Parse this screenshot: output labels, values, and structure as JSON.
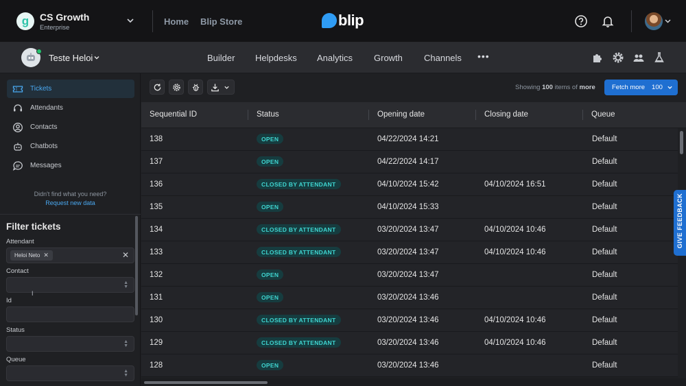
{
  "header": {
    "org_initial": "g",
    "org_name": "CS Growth",
    "org_plan": "Enterprise",
    "nav": [
      "Home",
      "Blip Store"
    ],
    "brand": "blip",
    "icons": [
      "help-circle-icon",
      "bell-icon",
      "avatar",
      "chevron-down-icon"
    ]
  },
  "subbar": {
    "bot_name": "Teste Heloi",
    "bot_status": "online",
    "nav": [
      "Builder",
      "Helpdesks",
      "Analytics",
      "Growth",
      "Channels"
    ],
    "more": "•••",
    "icons": [
      "puzzle-icon",
      "gear-icon",
      "users-icon",
      "flask-icon"
    ]
  },
  "sidebar": {
    "items": [
      {
        "label": "Tickets",
        "icon": "ticket-icon",
        "active": true
      },
      {
        "label": "Attendants",
        "icon": "headset-icon",
        "active": false
      },
      {
        "label": "Contacts",
        "icon": "user-circle-icon",
        "active": false
      },
      {
        "label": "Chatbots",
        "icon": "robot-icon",
        "active": false
      },
      {
        "label": "Messages",
        "icon": "message-icon",
        "active": false
      }
    ],
    "help_text": "Didn't find what you need?",
    "help_link": "Request new data"
  },
  "filters": {
    "title": "Filter tickets",
    "attendant_label": "Attendant",
    "attendant_chip": "Heloi Neto",
    "chip_remove": "✕",
    "clear": "✕",
    "contact_label": "Contact",
    "id_label": "Id",
    "status_label": "Status",
    "queue_label": "Queue"
  },
  "toolbar": {
    "buttons": [
      "refresh-icon",
      "settings-icon",
      "bug-icon",
      "download-icon"
    ],
    "showing_prefix": "Showing",
    "showing_count": "100",
    "showing_middle": "items of",
    "showing_suffix": "more",
    "fetch_label": "Fetch more",
    "fetch_count": "100"
  },
  "table": {
    "columns": [
      "Sequential ID",
      "Status",
      "Opening date",
      "Closing date",
      "Queue"
    ],
    "rows": [
      {
        "id": "138",
        "status": "OPEN",
        "opening": "04/22/2024 14:21",
        "closing": "",
        "queue": "Default"
      },
      {
        "id": "137",
        "status": "OPEN",
        "opening": "04/22/2024 14:17",
        "closing": "",
        "queue": "Default"
      },
      {
        "id": "136",
        "status": "CLOSED BY ATTENDANT",
        "opening": "04/10/2024 15:42",
        "closing": "04/10/2024 16:51",
        "queue": "Default"
      },
      {
        "id": "135",
        "status": "OPEN",
        "opening": "04/10/2024 15:33",
        "closing": "",
        "queue": "Default"
      },
      {
        "id": "134",
        "status": "CLOSED BY ATTENDANT",
        "opening": "03/20/2024 13:47",
        "closing": "04/10/2024 10:46",
        "queue": "Default"
      },
      {
        "id": "133",
        "status": "CLOSED BY ATTENDANT",
        "opening": "03/20/2024 13:47",
        "closing": "04/10/2024 10:46",
        "queue": "Default"
      },
      {
        "id": "132",
        "status": "OPEN",
        "opening": "03/20/2024 13:47",
        "closing": "",
        "queue": "Default"
      },
      {
        "id": "131",
        "status": "OPEN",
        "opening": "03/20/2024 13:46",
        "closing": "",
        "queue": "Default"
      },
      {
        "id": "130",
        "status": "CLOSED BY ATTENDANT",
        "opening": "03/20/2024 13:46",
        "closing": "04/10/2024 10:46",
        "queue": "Default"
      },
      {
        "id": "129",
        "status": "CLOSED BY ATTENDANT",
        "opening": "03/20/2024 13:46",
        "closing": "04/10/2024 10:46",
        "queue": "Default"
      },
      {
        "id": "128",
        "status": "OPEN",
        "opening": "03/20/2024 13:46",
        "closing": "",
        "queue": "Default"
      }
    ]
  },
  "feedback": {
    "label": "GIVE FEEDBACK"
  },
  "colors": {
    "accent": "#1f6fd1",
    "badge_text": "#3fd6d1",
    "badge_bg": "#163c3f",
    "active_menu": "#4aa8f0"
  }
}
